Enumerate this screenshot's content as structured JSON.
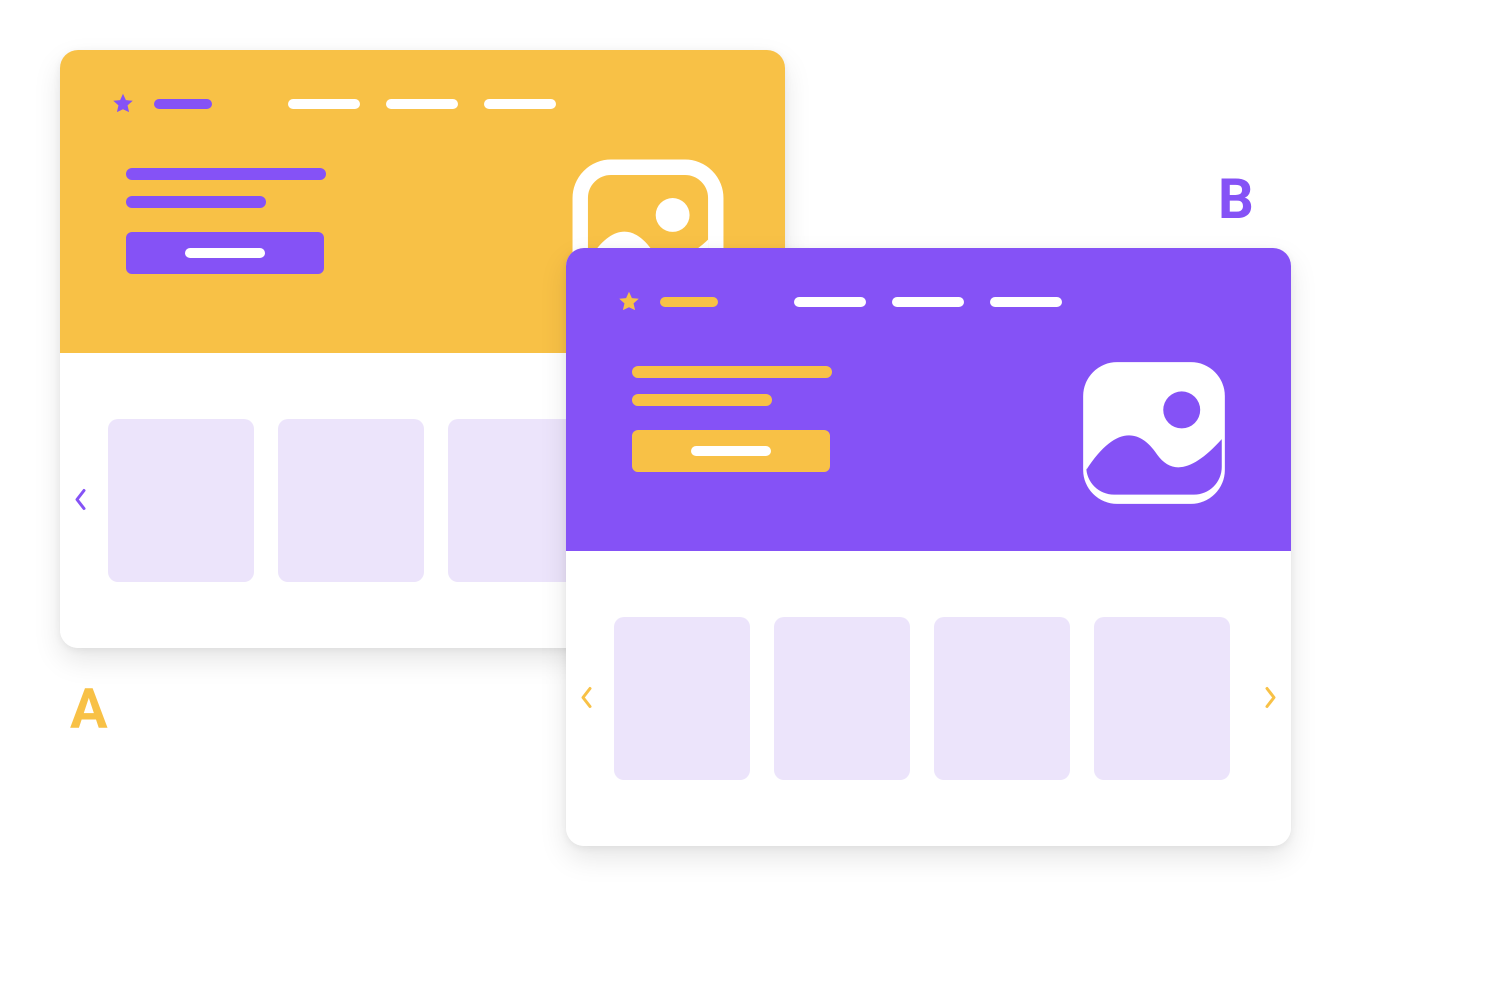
{
  "labels": {
    "a": "A",
    "b": "B"
  },
  "colors": {
    "yellow": "#f8c146",
    "purple": "#8552f6",
    "tile": "#ece4fb",
    "white": "#ffffff"
  },
  "variantA": {
    "primary": "#f8c146",
    "accent": "#8552f6",
    "nav_items": 3,
    "carousel_tiles": 3,
    "shows_right_arrow": false
  },
  "variantB": {
    "primary": "#8552f6",
    "accent": "#f8c146",
    "nav_items": 3,
    "carousel_tiles": 4,
    "shows_right_arrow": true
  }
}
